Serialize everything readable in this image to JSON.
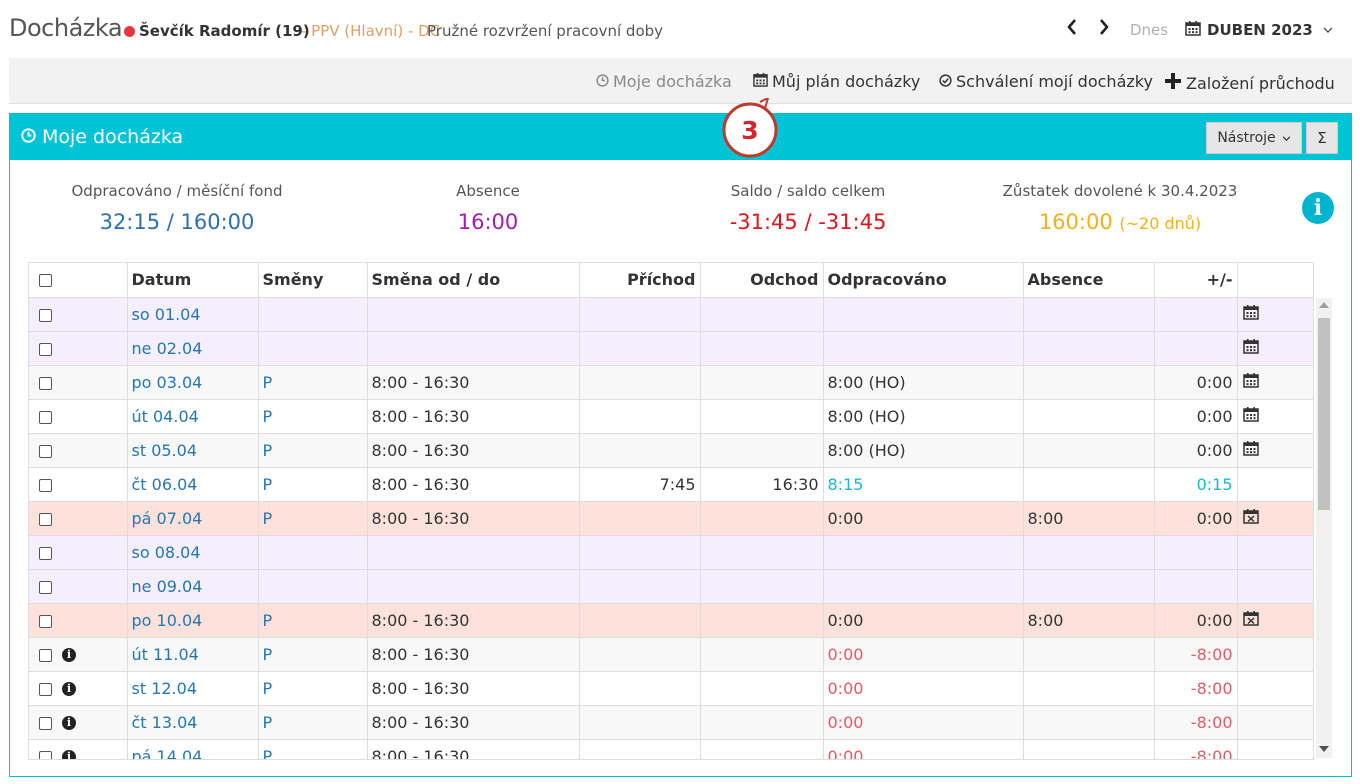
{
  "header": {
    "title": "Docházka",
    "person": "Ševčík Radomír (19)",
    "contract": "- PPV (Hlavní) - DC",
    "worktime": "Pružné rozvržení pracovní doby",
    "today": "Dnes",
    "month": "DUBEN 2023",
    "status_color": "#e8363f"
  },
  "toolbar": {
    "my_attendance": "Moje docházka",
    "my_plan": "Můj plán docházky",
    "approval": "Schválení mojí docházky",
    "create_pass": "Založení průchodu"
  },
  "callout": {
    "number": "3"
  },
  "panel": {
    "title": "Moje docházka",
    "tools_label": "Nástroje",
    "sigma_label": "Σ",
    "accent_color": "#00c3d6"
  },
  "stats": {
    "worked_label": "Odpracováno / měsíční fond",
    "worked_value": "32:15 / 160:00",
    "absence_label": "Absence",
    "absence_value": "16:00",
    "saldo_label": "Saldo / saldo celkem",
    "saldo_value": "-31:45 / -31:45",
    "vacation_label": "Zůstatek dovolené k 30.4.2023",
    "vacation_value": "160:00",
    "vacation_days": "(~20 dnů)"
  },
  "table": {
    "headers": {
      "date": "Datum",
      "shifts": "Směny",
      "shift_range": "Směna od / do",
      "arrival": "Příchod",
      "departure": "Odchod",
      "worked": "Odpracováno",
      "absence": "Absence",
      "diff": "+/-"
    },
    "rows": [
      {
        "date": "so 01.04",
        "shift": "",
        "range": "",
        "arr": "",
        "dep": "",
        "worked": "",
        "abs": "",
        "diff": "",
        "type": "weekend",
        "icon": "calendar",
        "info": false
      },
      {
        "date": "ne 02.04",
        "shift": "",
        "range": "",
        "arr": "",
        "dep": "",
        "worked": "",
        "abs": "",
        "diff": "",
        "type": "weekend",
        "icon": "calendar",
        "info": false
      },
      {
        "date": "po 03.04",
        "shift": "P",
        "range": "8:00 - 16:30",
        "arr": "",
        "dep": "",
        "worked": "8:00 (HO)",
        "abs": "",
        "diff": "0:00",
        "type": "odd",
        "icon": "calendar",
        "info": false
      },
      {
        "date": "út 04.04",
        "shift": "P",
        "range": "8:00 - 16:30",
        "arr": "",
        "dep": "",
        "worked": "8:00 (HO)",
        "abs": "",
        "diff": "0:00",
        "type": "even",
        "icon": "calendar",
        "info": false
      },
      {
        "date": "st 05.04",
        "shift": "P",
        "range": "8:00 - 16:30",
        "arr": "",
        "dep": "",
        "worked": "8:00 (HO)",
        "abs": "",
        "diff": "0:00",
        "type": "odd",
        "icon": "calendar",
        "info": false
      },
      {
        "date": "čt 06.04",
        "shift": "P",
        "range": "8:00 - 16:30",
        "arr": "7:45",
        "dep": "16:30",
        "worked": "8:15",
        "abs": "",
        "diff": "0:15",
        "type": "even",
        "icon": "",
        "info": false,
        "tone": "teal"
      },
      {
        "date": "pá 07.04",
        "shift": "P",
        "range": "8:00 - 16:30",
        "arr": "",
        "dep": "",
        "worked": "0:00",
        "abs": "8:00",
        "diff": "0:00",
        "type": "leave",
        "icon": "calendar-x",
        "info": false
      },
      {
        "date": "so 08.04",
        "shift": "",
        "range": "",
        "arr": "",
        "dep": "",
        "worked": "",
        "abs": "",
        "diff": "",
        "type": "weekend",
        "icon": "",
        "info": false
      },
      {
        "date": "ne 09.04",
        "shift": "",
        "range": "",
        "arr": "",
        "dep": "",
        "worked": "",
        "abs": "",
        "diff": "",
        "type": "weekend",
        "icon": "",
        "info": false
      },
      {
        "date": "po 10.04",
        "shift": "P",
        "range": "8:00 - 16:30",
        "arr": "",
        "dep": "",
        "worked": "0:00",
        "abs": "8:00",
        "diff": "0:00",
        "type": "leave",
        "icon": "calendar-x",
        "info": false
      },
      {
        "date": "út 11.04",
        "shift": "P",
        "range": "8:00 - 16:30",
        "arr": "",
        "dep": "",
        "worked": "0:00",
        "abs": "",
        "diff": "-8:00",
        "type": "odd",
        "icon": "",
        "info": true,
        "tone": "red"
      },
      {
        "date": "st 12.04",
        "shift": "P",
        "range": "8:00 - 16:30",
        "arr": "",
        "dep": "",
        "worked": "0:00",
        "abs": "",
        "diff": "-8:00",
        "type": "even",
        "icon": "",
        "info": true,
        "tone": "red"
      },
      {
        "date": "čt 13.04",
        "shift": "P",
        "range": "8:00 - 16:30",
        "arr": "",
        "dep": "",
        "worked": "0:00",
        "abs": "",
        "diff": "-8:00",
        "type": "odd",
        "icon": "",
        "info": true,
        "tone": "red"
      },
      {
        "date": "pá 14.04",
        "shift": "P",
        "range": "8:00 - 16:30",
        "arr": "",
        "dep": "",
        "worked": "0:00",
        "abs": "",
        "diff": "-8:00",
        "type": "even",
        "icon": "",
        "info": true,
        "tone": "red"
      }
    ]
  }
}
